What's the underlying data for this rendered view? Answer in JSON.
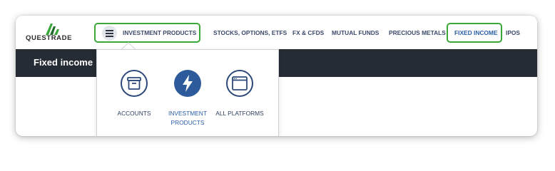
{
  "brand": {
    "logo_text": "QUESTRADE",
    "accent_color": "#3aa838",
    "dark_color": "#262c34"
  },
  "nav": {
    "investment_products": "INVESTMENT PRODUCTS",
    "items": [
      {
        "label": "STOCKS, OPTIONS, ETFS"
      },
      {
        "label": "FX & CFDS"
      },
      {
        "label": "MUTUAL FUNDS"
      },
      {
        "label": "PRECIOUS METALS"
      },
      {
        "label": "FIXED INCOME"
      },
      {
        "label": "IPOS"
      }
    ]
  },
  "banner": {
    "title": "Fixed income"
  },
  "dropdown": {
    "items": [
      {
        "label": "ACCOUNTS",
        "icon": "archive-box-icon"
      },
      {
        "label_line1": "INVESTMENT",
        "label_line2": "PRODUCTS",
        "icon": "lightning-bolt-icon"
      },
      {
        "label": "ALL PLATFORMS",
        "icon": "browser-window-icon"
      }
    ]
  }
}
